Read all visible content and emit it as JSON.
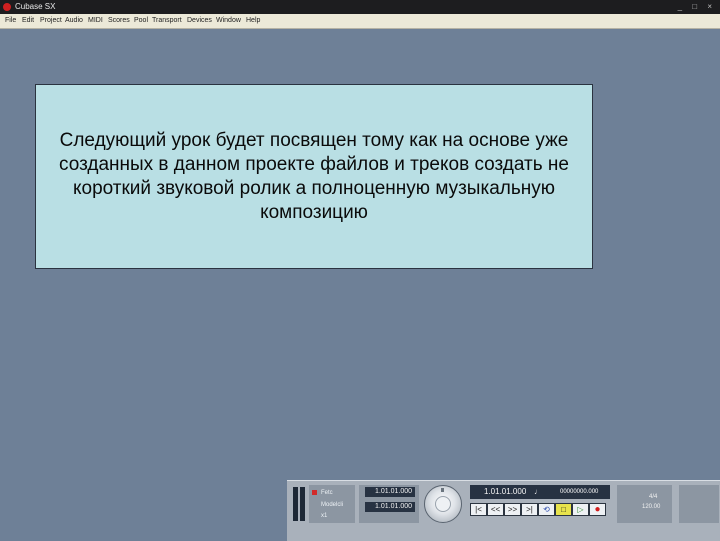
{
  "window": {
    "title": "Cubase SX",
    "controls": "_ □ ×"
  },
  "menubar": {
    "items": [
      {
        "label": "File"
      },
      {
        "label": "Edit"
      },
      {
        "label": "Project"
      },
      {
        "label": "Audio"
      },
      {
        "label": "MIDI"
      },
      {
        "label": "Scores"
      },
      {
        "label": "Pool"
      },
      {
        "label": "Transport"
      },
      {
        "label": "Devices"
      },
      {
        "label": "Window"
      },
      {
        "label": "Help"
      }
    ]
  },
  "message": {
    "text": "Следующий урок будет посвящен тому как на основе уже созданных в данном проекте файлов и треков создать не короткий звуковой ролик а полноценную музыкальную композицию"
  },
  "transport": {
    "left_labels": [
      "Fetc",
      "Modelcli",
      "x1"
    ],
    "left_pos": "1.01.01.000",
    "right_pos": "1.01.01.000",
    "main_position": "1.01.01.000",
    "main_note": "♩",
    "tempo_readout": "00000000.000",
    "buttons": {
      "to_start": "|<",
      "rewind": "<<",
      "forward": ">>",
      "to_end": ">|",
      "cycle": "⟲",
      "stop": "□",
      "play": "▷",
      "record": "●"
    },
    "signature": {
      "sig": "4/4",
      "tempo": "120.00"
    },
    "accent_colors": {
      "record": "#d21e1e",
      "stop": "#e8e34c",
      "display": "#273242"
    }
  }
}
